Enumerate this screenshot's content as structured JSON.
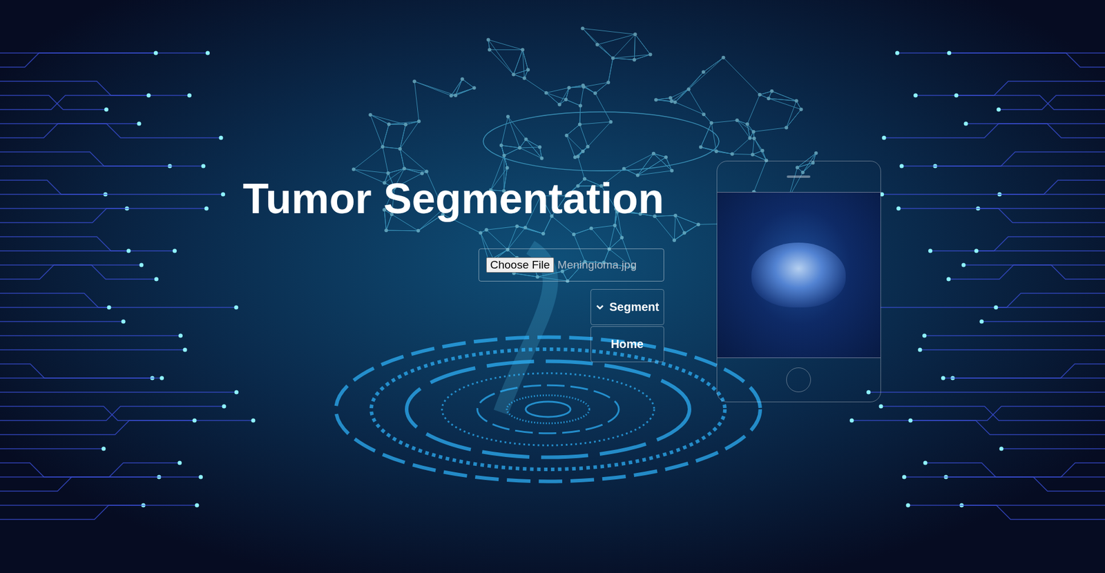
{
  "page": {
    "title": "Tumor Segmentation"
  },
  "file_input": {
    "button": "Choose File",
    "file_name": "Meningioma.jpg"
  },
  "buttons": [
    {
      "label": "Segment",
      "kind": "icon"
    },
    {
      "label": "Home",
      "kind": "text"
    }
  ]
}
